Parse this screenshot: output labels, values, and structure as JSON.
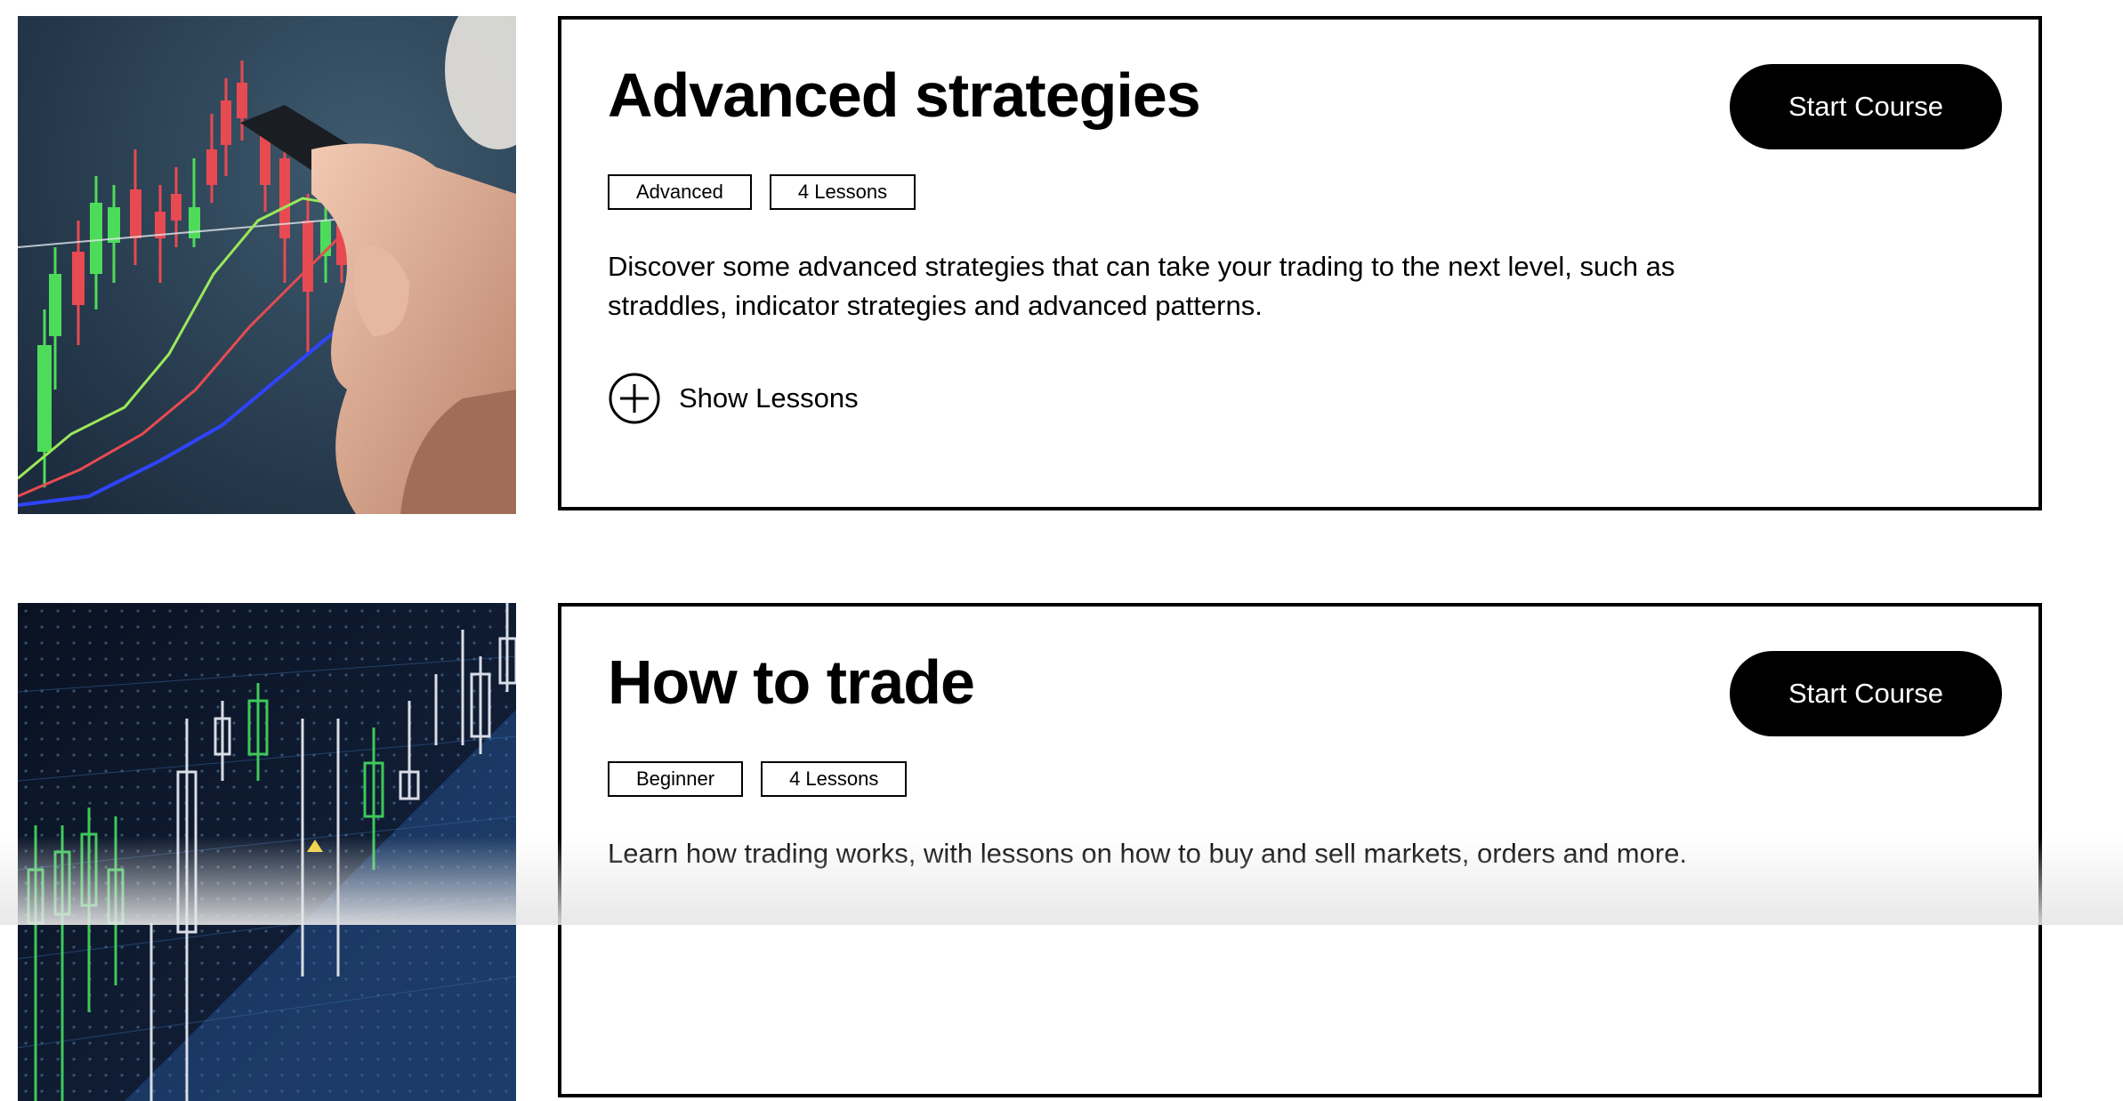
{
  "courses": [
    {
      "title": "Advanced strategies",
      "level": "Advanced",
      "lessons": "4 Lessons",
      "description": "Discover some advanced strategies that can take your trading to the next level, such as straddles, indicator strategies and advanced patterns.",
      "show_lessons_label": "Show Lessons",
      "start_label": "Start Course",
      "image_icon": "candlestick-chart-photo"
    },
    {
      "title": "How to trade",
      "level": "Beginner",
      "lessons": "4 Lessons",
      "description": "Learn how trading works, with lessons on how to buy and sell markets, orders and more.",
      "start_label": "Start Course",
      "image_icon": "trading-chart-photo"
    }
  ],
  "colors": {
    "accent": "#000000",
    "button_text": "#ffffff",
    "candle_up": "#4ddc5a",
    "candle_down": "#e84a52"
  }
}
